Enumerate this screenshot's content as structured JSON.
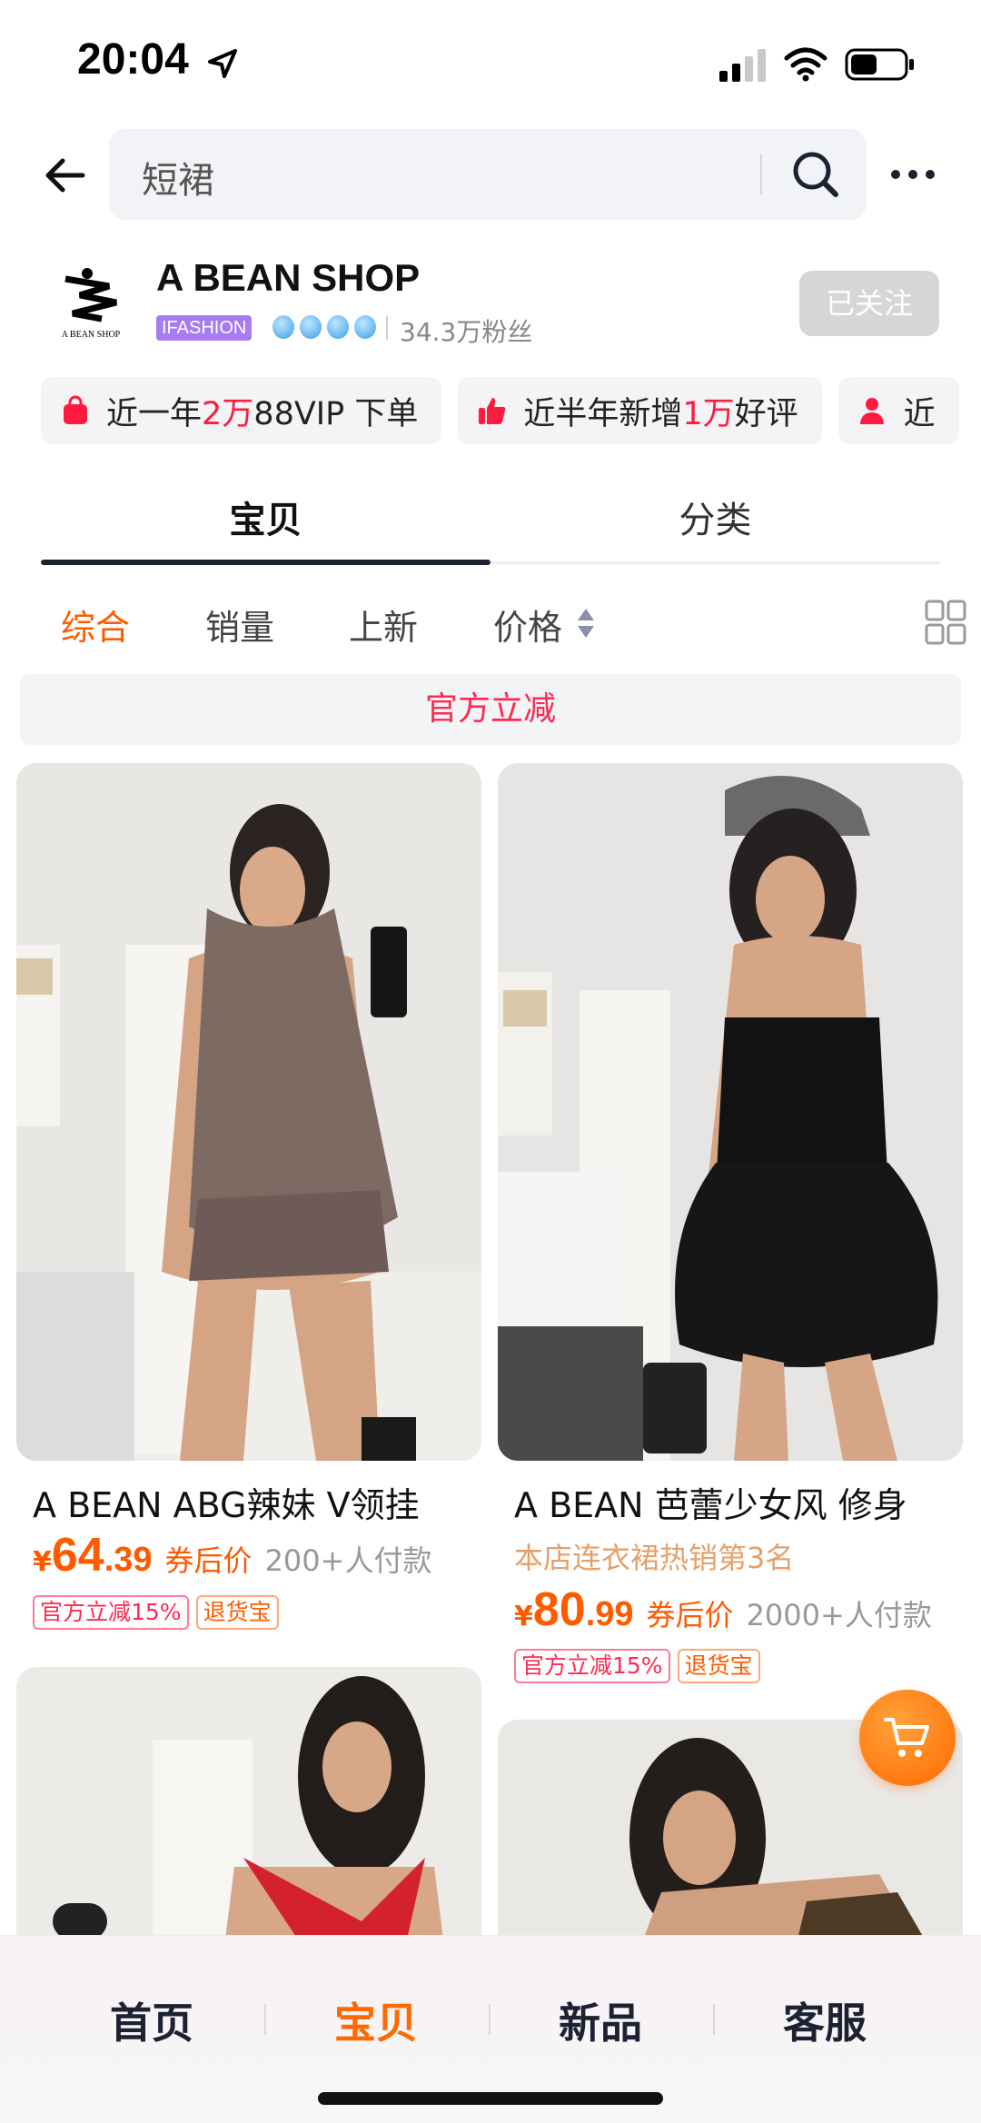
{
  "status_bar": {
    "time": "20:04"
  },
  "search": {
    "query": "短裙"
  },
  "shop": {
    "name": "A BEAN SHOP",
    "badge": "IFASHION",
    "fans": "34.3万粉丝",
    "follow_label": "已关注",
    "logo_text": "A BEAN SHOP"
  },
  "chips": [
    {
      "icon": "shopping-bag-icon",
      "prefix": "近一年",
      "highlight": "2万",
      "suffix": "88VIP 下单"
    },
    {
      "icon": "thumbs-up-icon",
      "prefix": "近半年新增",
      "highlight": "1万",
      "suffix": "好评"
    },
    {
      "icon": "user-icon",
      "prefix": "近",
      "highlight": "",
      "suffix": ""
    }
  ],
  "tabs": {
    "active": "宝贝",
    "other": "分类"
  },
  "sort": {
    "items": [
      "综合",
      "销量",
      "上新",
      "价格"
    ],
    "active": "综合"
  },
  "banner": {
    "label": "官方立减"
  },
  "products": [
    {
      "title": "A BEAN ABG辣妹 V领挂",
      "rank": "",
      "currency": "¥",
      "price_int": "64",
      "price_dec": ".39",
      "price_note": "券后价",
      "sold": "200+人付款",
      "tags": [
        "官方立减15%",
        "退货宝"
      ]
    },
    {
      "title": "A BEAN 芭蕾少女风 修身",
      "rank": "本店连衣裙热销第3名",
      "currency": "¥",
      "price_int": "80",
      "price_dec": ".99",
      "price_note": "券后价",
      "sold": "2000+人付款",
      "tags": [
        "官方立减15%",
        "退货宝"
      ]
    }
  ],
  "bottom_nav": {
    "items": [
      "首页",
      "宝贝",
      "新品",
      "客服"
    ],
    "active": "宝贝"
  },
  "colors": {
    "accent": "#ff5a00",
    "highlight_red": "#ff1a40",
    "nav_dark": "#1c2232"
  }
}
